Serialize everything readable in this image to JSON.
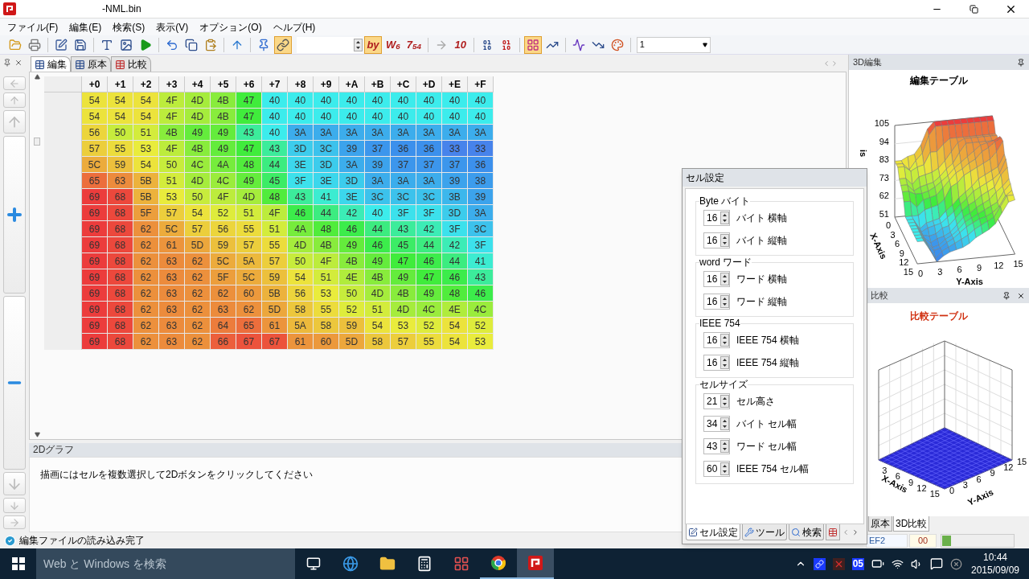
{
  "window": {
    "title": "-NML.bin"
  },
  "menu": [
    "ファイル(F)",
    "編集(E)",
    "検索(S)",
    "表示(V)",
    "オプション(O)",
    "ヘルプ(H)"
  ],
  "toolbar": [
    {
      "kind": "icon",
      "active": false
    },
    {
      "kind": "icon",
      "active": false
    },
    {
      "kind": "sep"
    },
    {
      "kind": "icon",
      "active": false
    },
    {
      "kind": "icon",
      "active": false
    },
    {
      "kind": "sep"
    },
    {
      "kind": "icon",
      "active": false
    },
    {
      "kind": "icon",
      "active": false
    },
    {
      "kind": "icon",
      "active": false
    },
    {
      "kind": "sep"
    },
    {
      "kind": "icon",
      "active": false
    },
    {
      "kind": "icon",
      "active": false
    },
    {
      "kind": "icon",
      "active": false
    },
    {
      "kind": "sep"
    },
    {
      "kind": "icon",
      "active": false
    },
    {
      "kind": "sep"
    },
    {
      "kind": "icon",
      "active": false
    },
    {
      "kind": "icon",
      "active": true
    },
    {
      "kind": "spin"
    },
    {
      "kind": "glyph",
      "label": "by",
      "active": true
    },
    {
      "kind": "glyph",
      "label": "W$_{6}$",
      "active": false
    },
    {
      "kind": "glyph",
      "label": "7$_{54}$",
      "active": false
    },
    {
      "kind": "sep"
    },
    {
      "kind": "icon",
      "active": false
    },
    {
      "kind": "glyph",
      "label": "10",
      "active": false
    },
    {
      "kind": "sep"
    },
    {
      "kind": "icon",
      "active": false
    },
    {
      "kind": "icon",
      "active": false
    },
    {
      "kind": "sep"
    },
    {
      "kind": "icon",
      "active": true
    },
    {
      "kind": "icon",
      "active": false
    },
    {
      "kind": "sep"
    },
    {
      "kind": "icon",
      "active": false
    },
    {
      "kind": "icon",
      "active": false
    },
    {
      "kind": "icon",
      "active": false
    },
    {
      "kind": "sep"
    },
    {
      "kind": "combo",
      "value": "1"
    }
  ],
  "doc_tabs": [
    {
      "label": "編集",
      "selected": true
    },
    {
      "label": "原本",
      "selected": false
    },
    {
      "label": "比較",
      "selected": false
    }
  ],
  "grid": {
    "columns": [
      "+0",
      "+1",
      "+2",
      "+3",
      "+4",
      "+5",
      "+6",
      "+7",
      "+8",
      "+9",
      "+A",
      "+B",
      "+C",
      "+D",
      "+E",
      "+F"
    ],
    "rows": [
      [
        "54",
        "54",
        "54",
        "4F",
        "4D",
        "4B",
        "47",
        "40",
        "40",
        "40",
        "40",
        "40",
        "40",
        "40",
        "40",
        "40"
      ],
      [
        "54",
        "54",
        "54",
        "4F",
        "4D",
        "4B",
        "47",
        "40",
        "40",
        "40",
        "40",
        "40",
        "40",
        "40",
        "40",
        "40"
      ],
      [
        "56",
        "50",
        "51",
        "4B",
        "49",
        "49",
        "43",
        "40",
        "3A",
        "3A",
        "3A",
        "3A",
        "3A",
        "3A",
        "3A",
        "3A"
      ],
      [
        "57",
        "55",
        "53",
        "4F",
        "4B",
        "49",
        "47",
        "43",
        "3D",
        "3C",
        "39",
        "37",
        "36",
        "36",
        "33",
        "33"
      ],
      [
        "5C",
        "59",
        "54",
        "50",
        "4C",
        "4A",
        "48",
        "44",
        "3E",
        "3D",
        "3A",
        "39",
        "37",
        "37",
        "37",
        "36"
      ],
      [
        "65",
        "63",
        "5B",
        "51",
        "4D",
        "4C",
        "49",
        "45",
        "3F",
        "3E",
        "3D",
        "3A",
        "3A",
        "3A",
        "39",
        "38"
      ],
      [
        "69",
        "68",
        "5B",
        "53",
        "50",
        "4F",
        "4D",
        "48",
        "43",
        "41",
        "3E",
        "3C",
        "3C",
        "3C",
        "3B",
        "39"
      ],
      [
        "69",
        "68",
        "5F",
        "57",
        "54",
        "52",
        "51",
        "4F",
        "46",
        "44",
        "42",
        "40",
        "3F",
        "3F",
        "3D",
        "3A"
      ],
      [
        "69",
        "68",
        "62",
        "5C",
        "57",
        "56",
        "55",
        "51",
        "4A",
        "48",
        "46",
        "44",
        "43",
        "42",
        "3F",
        "3C"
      ],
      [
        "69",
        "68",
        "62",
        "61",
        "5D",
        "59",
        "57",
        "55",
        "4D",
        "4B",
        "49",
        "46",
        "45",
        "44",
        "42",
        "3F"
      ],
      [
        "69",
        "68",
        "62",
        "63",
        "62",
        "5C",
        "5A",
        "57",
        "50",
        "4F",
        "4B",
        "49",
        "47",
        "46",
        "44",
        "41"
      ],
      [
        "69",
        "68",
        "62",
        "63",
        "62",
        "5F",
        "5C",
        "59",
        "54",
        "51",
        "4E",
        "4B",
        "49",
        "47",
        "46",
        "43"
      ],
      [
        "69",
        "68",
        "62",
        "63",
        "62",
        "62",
        "60",
        "5B",
        "56",
        "53",
        "50",
        "4D",
        "4B",
        "49",
        "48",
        "46"
      ],
      [
        "69",
        "68",
        "62",
        "63",
        "62",
        "63",
        "62",
        "5D",
        "58",
        "55",
        "52",
        "51",
        "4D",
        "4C",
        "4E",
        "4C"
      ],
      [
        "69",
        "68",
        "62",
        "63",
        "62",
        "64",
        "65",
        "61",
        "5A",
        "58",
        "59",
        "54",
        "53",
        "52",
        "54",
        "52"
      ],
      [
        "69",
        "68",
        "62",
        "63",
        "62",
        "66",
        "67",
        "67",
        "61",
        "60",
        "5D",
        "58",
        "57",
        "55",
        "54",
        "53"
      ]
    ]
  },
  "graph_2d": {
    "title": "2Dグラフ",
    "message": "描画にはセルを複数選択して2Dボタンをクリックしてください"
  },
  "status": {
    "message": "編集ファイルの読み込み完了",
    "field_1": "EF2",
    "field_2": "00",
    "progress": {
      "level": 0.12
    }
  },
  "panel_3d_edit": {
    "title": "3D編集",
    "chart_title": "編集テーブル",
    "z_label": "is",
    "z_ticks": [
      "105",
      "94",
      "83",
      "73",
      "62",
      "51"
    ],
    "x_label": "X-Axis",
    "x_ticks": [
      "0",
      "3",
      "6",
      "9",
      "12",
      "15"
    ],
    "y_label": "Y-Axis",
    "y_ticks": [
      "0",
      "3",
      "6",
      "9",
      "12",
      "15"
    ]
  },
  "panel_3d_compare": {
    "title": "比較",
    "chart_title": "比較テーブル",
    "x_label": "X-Axis",
    "x_ticks": [
      "3",
      "6",
      "9",
      "12",
      "15"
    ],
    "y_label": "Y-Axis",
    "y_ticks": [
      "0",
      "3",
      "6",
      "9",
      "12",
      "15"
    ]
  },
  "panel_tabs": [
    {
      "label": "原本",
      "selected": false
    },
    {
      "label": "3D比較",
      "selected": true
    }
  ],
  "cell_settings": {
    "title": "セル設定",
    "groups": [
      {
        "title": "Byte バイト",
        "rows": [
          {
            "value": "16",
            "label": "バイト 横軸"
          },
          {
            "value": "16",
            "label": "バイト 縦軸"
          }
        ]
      },
      {
        "title": "word ワード",
        "rows": [
          {
            "value": "16",
            "label": "ワード 横軸"
          },
          {
            "value": "16",
            "label": "ワード 縦軸"
          }
        ]
      },
      {
        "title": "IEEE 754",
        "rows": [
          {
            "value": "16",
            "label": "IEEE 754 横軸"
          },
          {
            "value": "16",
            "label": "IEEE 754 縦軸"
          }
        ]
      },
      {
        "title": "セルサイズ",
        "rows": [
          {
            "value": "21",
            "label": "セル高さ"
          },
          {
            "value": "34",
            "label": "バイト セル幅"
          },
          {
            "value": "43",
            "label": "ワード セル幅"
          },
          {
            "value": "60",
            "label": "IEEE 754 セル幅"
          }
        ]
      }
    ],
    "tabs": [
      {
        "label": "セル設定",
        "selected": true
      },
      {
        "label": "ツール",
        "selected": false
      },
      {
        "label": "検索",
        "selected": false
      }
    ]
  },
  "taskbar": {
    "search_placeholder": "Web と Windows を検索",
    "apps": [
      {
        "running": false,
        "active": false
      },
      {
        "running": false,
        "active": false
      },
      {
        "running": false,
        "active": false
      },
      {
        "running": false,
        "active": false
      },
      {
        "running": false,
        "active": false
      },
      {
        "running": true,
        "active": false
      },
      {
        "running": true,
        "active": true
      }
    ],
    "tray_badge": "05",
    "time": "10:44",
    "date": "2015/09/09"
  }
}
